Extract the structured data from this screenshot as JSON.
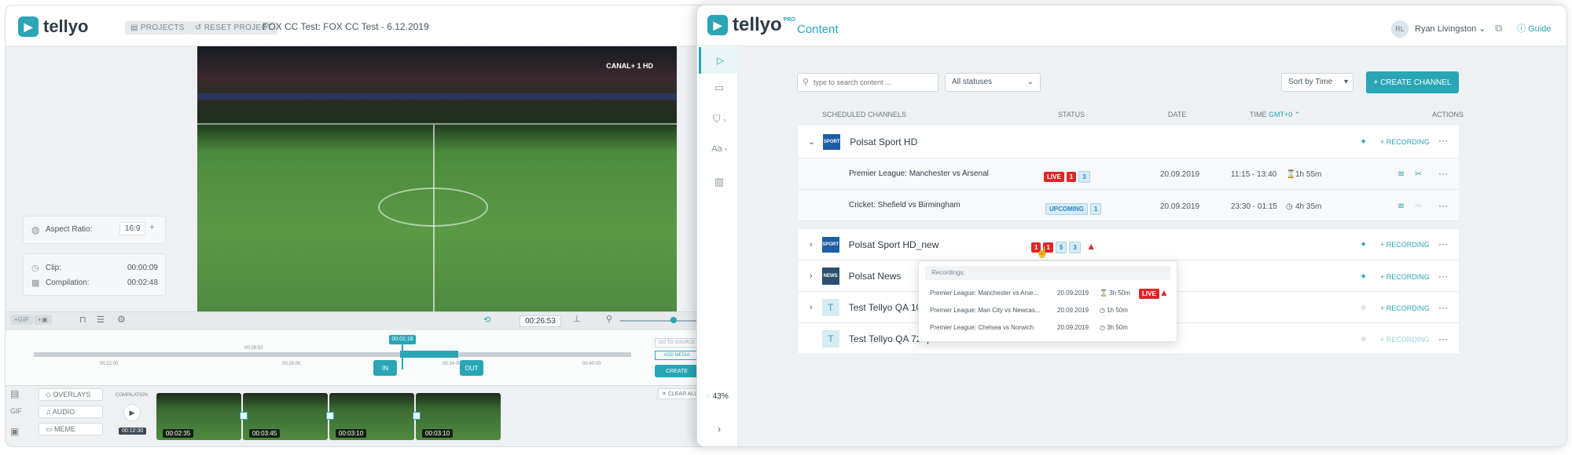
{
  "editor": {
    "logo_text": "tellyo",
    "projects_label": "PROJECTS",
    "reset_label": "RESET PROJECT",
    "project_title": "FOX CC Test: FOX CC Test - 6.12.2019",
    "video_badge": "CANAL+ 1 HD",
    "aspect_label": "Aspect Ratio:",
    "aspect_value": "16:9",
    "clip_label": "Clip:",
    "clip_value": "00:00:09",
    "compilation_label": "Compilation:",
    "compilation_value": "00:02:48",
    "gif_btn": "+GIF",
    "timecode": "00:26:53",
    "cursor_time": "00:01:18",
    "marker_top": "00:26:53",
    "ticks": [
      "00:22:00",
      "00:26:00",
      "00:34:00",
      "00:40:00"
    ],
    "in_label": "IN",
    "out_label": "OUT",
    "goto_source": "GO TO SOURCE",
    "add_media": "ADD MEDIA",
    "create": "CREATE",
    "clear_all": "CLEAR ALL",
    "overlays": "OVERLAYS",
    "audio": "AUDIO",
    "meme": "MEME",
    "compilation_caption": "COMPILATION",
    "compilation_time": "00:12:30",
    "thumbs": [
      "00:02:35",
      "00:03:45",
      "00:03:10",
      "00:03:10"
    ]
  },
  "content": {
    "logo_text": "tellyo",
    "logo_pro": "PRO",
    "page_title": "Content",
    "user_initials": "RL",
    "user_name": "Ryan Livingston",
    "guide": "Guide",
    "search_placeholder": "type to search content ...",
    "status_filter": "All statuses",
    "sort": "Sort by Time",
    "create_channel": "+ CREATE CHANNEL",
    "progress": "43%",
    "columns": {
      "scheduled": "SCHEDULED CHANNELS",
      "status": "STATUS",
      "date": "DATE",
      "time": "TIME",
      "gmt": "GMT+0",
      "actions": "ACTIONS"
    },
    "recording_label": "+ RECORDING",
    "channels": [
      {
        "name": "Polsat Sport HD",
        "logo": "SPORT"
      },
      {
        "name": "Polsat Sport HD_new",
        "logo": "SPORT"
      },
      {
        "name": "Polsat News",
        "logo": "NEWS"
      },
      {
        "name": "Test Tellyo QA 10",
        "logo": "T"
      },
      {
        "name": "Test Tellyo QA 720p25",
        "logo": "T"
      }
    ],
    "events": [
      {
        "title": "Premier League: Manchester vs Arsenal",
        "status": [
          "LIVE",
          "1",
          "3"
        ],
        "date": "20.09.2019",
        "time": "11:15 - 13:40",
        "duration": "1h 55m"
      },
      {
        "title": "Cricket: Shefield vs Birmingham",
        "status": [
          "UPCOMING",
          "1"
        ],
        "date": "20.09.2019",
        "time": "23:30 - 01:15",
        "duration": "4h 35m"
      }
    ],
    "hd_new_status": [
      "1",
      "1",
      "5",
      "3"
    ],
    "popup": {
      "title": "Recordings:",
      "rows": [
        {
          "title": "Premier League: Manchester vs Arse...",
          "date": "20.09.2019",
          "duration": "3h 50m",
          "badge": "LIVE"
        },
        {
          "title": "Premier League: Man City vs Newcas...",
          "date": "20.09.2019",
          "duration": "1h 50m"
        },
        {
          "title": "Premier League: Chelsea vs Norwich",
          "date": "20.09.2019",
          "duration": "3h 50m"
        }
      ]
    },
    "colors": {
      "accent": "#2aa5b5",
      "live": "#e0262b",
      "warning": "#e0262b"
    }
  }
}
